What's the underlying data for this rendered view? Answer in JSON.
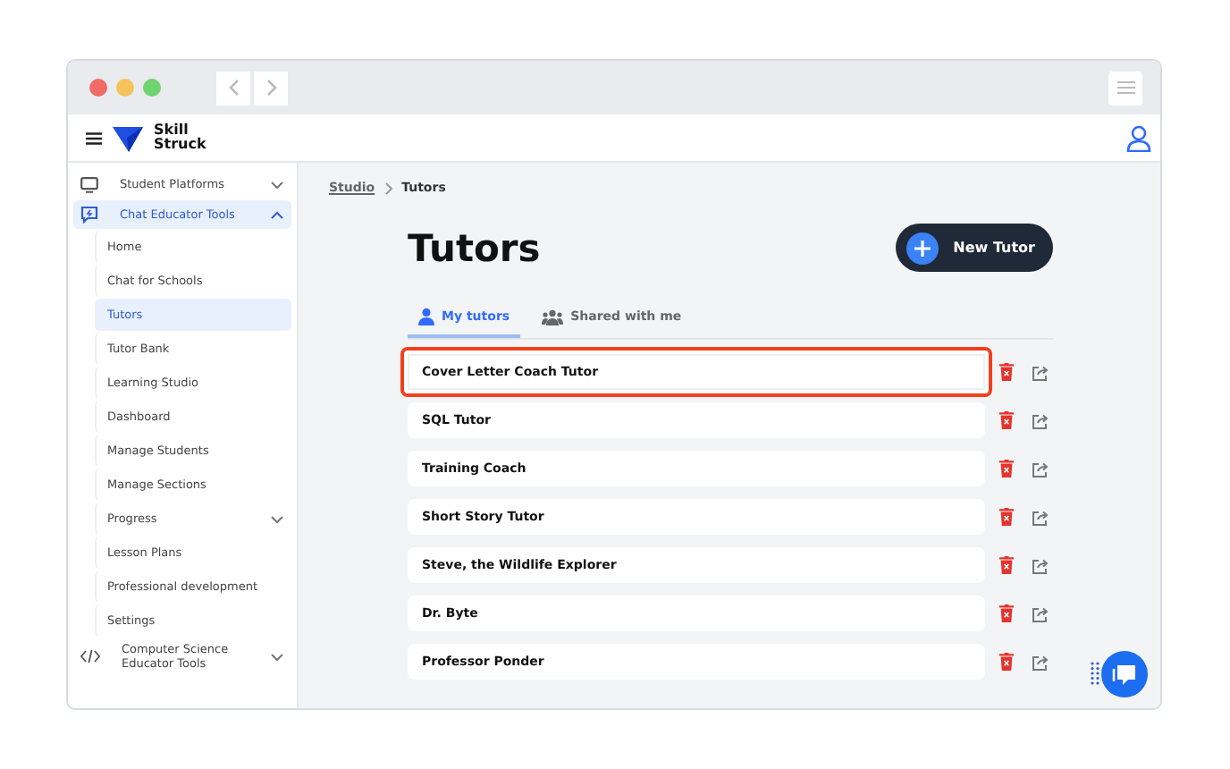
{
  "brand": {
    "name": "Skill Struck"
  },
  "sidebar": {
    "items": [
      {
        "label": "Student Platforms",
        "kind": "group",
        "expanded": false,
        "selected": false
      },
      {
        "label": "Chat Educator Tools",
        "kind": "group",
        "expanded": true,
        "selected": true
      },
      {
        "label": "Home",
        "kind": "link",
        "selected": false
      },
      {
        "label": "Chat for Schools",
        "kind": "link",
        "selected": false
      },
      {
        "label": "Tutors",
        "kind": "link",
        "selected": true
      },
      {
        "label": "Tutor Bank",
        "kind": "link",
        "selected": false
      },
      {
        "label": "Learning Studio",
        "kind": "link",
        "selected": false
      },
      {
        "label": "Dashboard",
        "kind": "link",
        "selected": false
      },
      {
        "label": "Manage Students",
        "kind": "link",
        "selected": false
      },
      {
        "label": "Manage Sections",
        "kind": "link",
        "selected": false
      },
      {
        "label": "Progress",
        "kind": "sub",
        "expanded": false,
        "selected": false
      },
      {
        "label": "Lesson Plans",
        "kind": "link",
        "selected": false
      },
      {
        "label": "Professional development",
        "kind": "link",
        "selected": false
      },
      {
        "label": "Settings",
        "kind": "link",
        "selected": false
      },
      {
        "label": "Computer Science Educator Tools",
        "kind": "group",
        "expanded": false,
        "selected": false
      }
    ]
  },
  "breadcrumb": [
    "Studio",
    "Tutors"
  ],
  "title": "Tutors",
  "new_button": "New Tutor",
  "tabs": [
    {
      "label": "My tutors",
      "selected": true
    },
    {
      "label": "Shared with me",
      "selected": false
    }
  ],
  "tutors": [
    {
      "name": "Cover Letter Coach Tutor",
      "highlighted": true
    },
    {
      "name": "SQL Tutor",
      "highlighted": false
    },
    {
      "name": "Training Coach",
      "highlighted": false
    },
    {
      "name": "Short Story Tutor",
      "highlighted": false
    },
    {
      "name": "Steve, the Wildlife Explorer",
      "highlighted": false
    },
    {
      "name": "Dr. Byte",
      "highlighted": false
    },
    {
      "name": "Professor Ponder",
      "highlighted": false
    }
  ]
}
